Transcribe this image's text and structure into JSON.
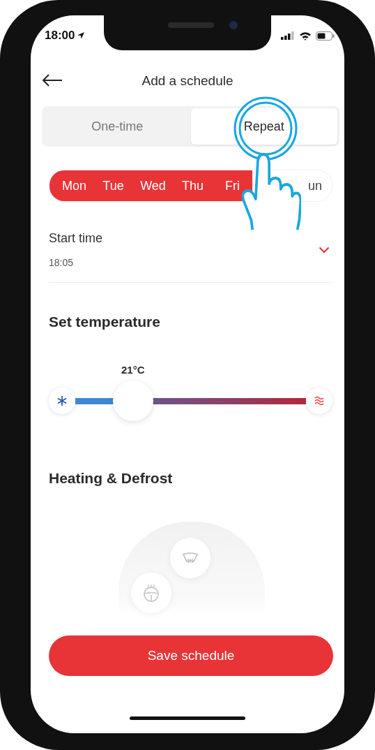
{
  "status_bar": {
    "time": "18:00"
  },
  "header": {
    "title": "Add a schedule"
  },
  "mode_tabs": [
    {
      "label": "One-time",
      "selected": false
    },
    {
      "label": "Repeat",
      "selected": true
    }
  ],
  "days": [
    {
      "label": "Mon",
      "selected": true
    },
    {
      "label": "Tue",
      "selected": true
    },
    {
      "label": "Wed",
      "selected": true
    },
    {
      "label": "Thu",
      "selected": true
    },
    {
      "label": "Fri",
      "selected": true
    },
    {
      "label": "un",
      "selected": false
    }
  ],
  "start_time": {
    "label": "Start time",
    "value": "18:05",
    "expanded": false
  },
  "temperature": {
    "title": "Set temperature",
    "reading": "21°C",
    "level": 0.25
  },
  "heating": {
    "title": "Heating & Defrost"
  },
  "save_button": {
    "label": "Save schedule"
  }
}
